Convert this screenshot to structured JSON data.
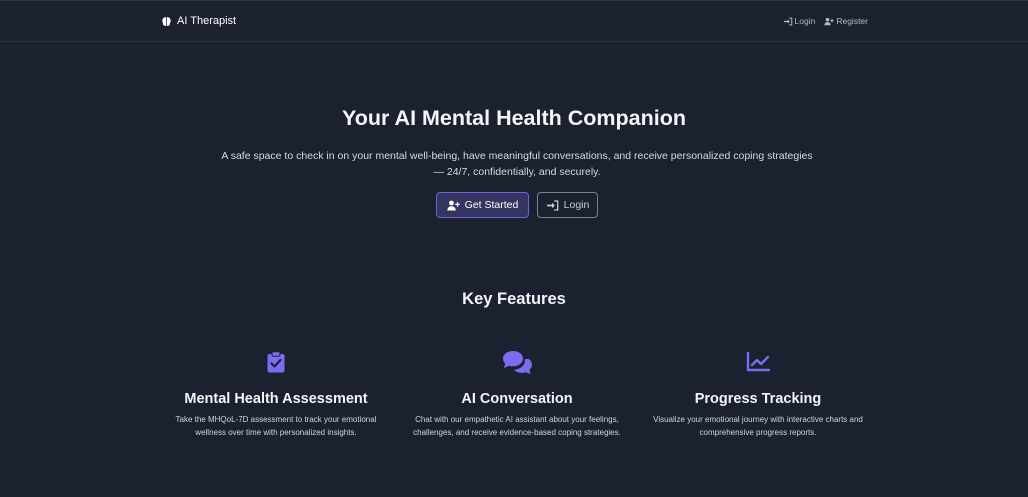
{
  "nav": {
    "brand": "AI Therapist",
    "login": "Login",
    "register": "Register"
  },
  "hero": {
    "title": "Your AI Mental Health Companion",
    "subtitle": "A safe space to check in on your mental well-being, have meaningful conversations, and receive personalized coping strategies — 24/7, confidentially, and securely.",
    "primary_button": "Get Started",
    "secondary_button": "Login"
  },
  "features": {
    "title": "Key Features",
    "items": [
      {
        "icon": "clipboard-check-icon",
        "title": "Mental Health Assessment",
        "description": "Take the MHQoL-7D assessment to track your emotional wellness over time with personalized insights."
      },
      {
        "icon": "chat-bubbles-icon",
        "title": "AI Conversation",
        "description": "Chat with our empathetic AI assistant about your feelings, challenges, and receive evidence-based coping strategies."
      },
      {
        "icon": "chart-line-icon",
        "title": "Progress Tracking",
        "description": "Visualize your emotional journey with interactive charts and comprehensive progress reports."
      }
    ]
  },
  "colors": {
    "background": "#1c2130",
    "accent": "#7c6cf0",
    "primary_button_bg": "#363561"
  }
}
